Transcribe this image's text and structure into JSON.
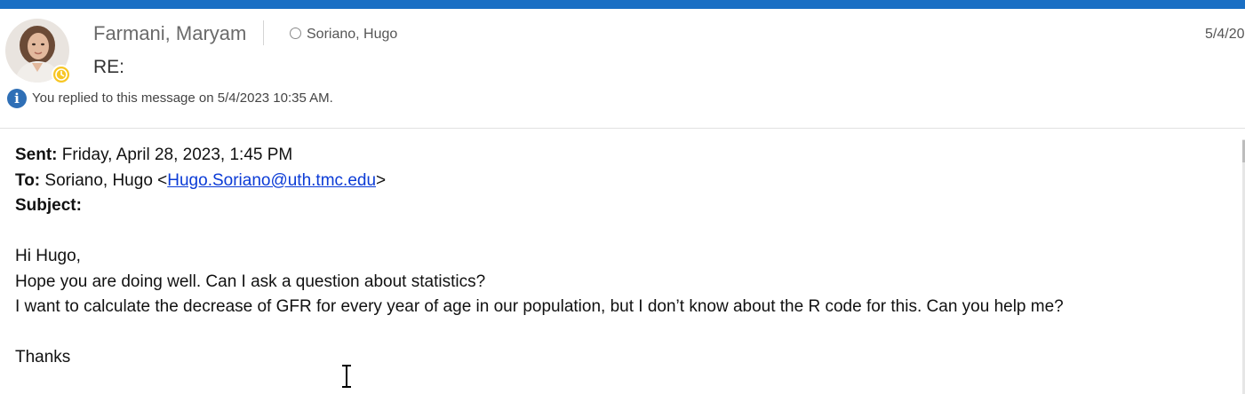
{
  "header": {
    "sender_name": "Farmani, Maryam",
    "recipient_name": "Soriano, Hugo",
    "date_fragment": "5/4/20",
    "subject": "RE:",
    "info_message": "You replied to this message on 5/4/2023 10:35 AM."
  },
  "message": {
    "sent_label": "Sent:",
    "sent_value": " Friday, April 28, 2023, 1:45 PM",
    "to_label": "To:",
    "to_name": " Soriano, Hugo <",
    "to_email": "Hugo.Soriano@uth.tmc.edu",
    "to_close": ">",
    "subject_label": "Subject:",
    "greeting": "Hi Hugo,",
    "line1": "Hope you are doing well. Can I ask a question about statistics?",
    "line2": "I want to calculate the decrease of GFR for every year of age in our population, but I don’t know about the R code for this. Can you help me?",
    "closing": "Thanks"
  },
  "icons": {
    "presence": "clock-away-icon",
    "info": "info-icon",
    "recipient_status": "presence-circle-icon",
    "cursor": "text-cursor-icon"
  },
  "colors": {
    "accent_bar": "#1a6fc4",
    "presence_away": "#f7c624",
    "info_blue": "#2f6fb6",
    "link": "#0b3bd6"
  }
}
